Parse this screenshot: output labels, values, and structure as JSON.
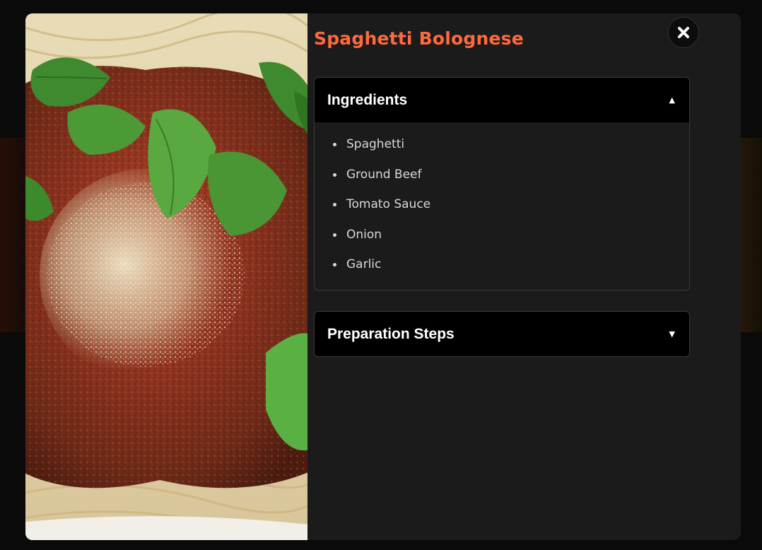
{
  "modal": {
    "title": "Spaghetti Bolognese",
    "close_icon": "close-icon",
    "photo_alt": "plate of spaghetti bolognese with basil and parmesan"
  },
  "accordions": [
    {
      "title": "Ingredients",
      "expanded": true,
      "caret": "▲",
      "items": [
        "Spaghetti",
        "Ground Beef",
        "Tomato Sauce",
        "Onion",
        "Garlic"
      ]
    },
    {
      "title": "Preparation Steps",
      "expanded": false,
      "caret": "▼",
      "items": []
    }
  ],
  "colors": {
    "accent": "#ff6a3d",
    "modal_bg": "#1b1b1b",
    "header_bg": "#000000",
    "text": "#d8d8d8"
  }
}
